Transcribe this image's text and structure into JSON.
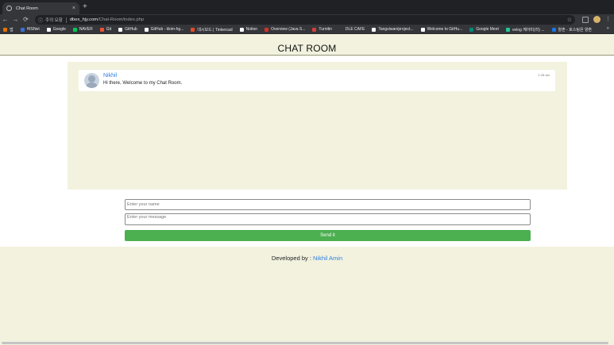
{
  "browser": {
    "tab_title": "Chat Room",
    "tab_close": "×",
    "new_tab": "+",
    "back": "←",
    "forward": "→",
    "reload": "⟳",
    "security_label": "주의 요함",
    "url_host": "dbex_hjy.com",
    "url_path": "/Chat-Room/index.php",
    "star": "☆",
    "more": "⋮",
    "bookmarks": [
      {
        "label": "앱",
        "color": "#e37400"
      },
      {
        "label": "HISNet",
        "color": "#3b6fd8"
      },
      {
        "label": "Google",
        "color": "#ffffff"
      },
      {
        "label": "NAVER",
        "color": "#03c75a"
      },
      {
        "label": "Git",
        "color": "#f05133"
      },
      {
        "label": "GitHub",
        "color": "#ffffff"
      },
      {
        "label": "GitHub - kkim-hg...",
        "color": "#ffffff"
      },
      {
        "label": "대시보드 | Tinkercad",
        "color": "#e84a27"
      },
      {
        "label": "Notion",
        "color": "#ffffff"
      },
      {
        "label": "Overview (Java S...",
        "color": "#d93025"
      },
      {
        "label": "Turnitin",
        "color": "#d33d3d"
      },
      {
        "label": "DLE CAFE",
        "color": "#35363a"
      },
      {
        "label": "Tangsiwan/project...",
        "color": "#ffffff"
      },
      {
        "label": "Welcome to GitHu...",
        "color": "#ffffff"
      },
      {
        "label": "Google Meet",
        "color": "#00897b"
      },
      {
        "label": "velog 께아미(라) ...",
        "color": "#20c997"
      },
      {
        "label": "양혼 - 호스팅은 양혼",
        "color": "#1a73e8"
      }
    ],
    "bookmarks_more": "»"
  },
  "page": {
    "title": "CHAT ROOM",
    "messages": [
      {
        "sender": "Nikhil",
        "text": "Hi there, Welcome to my Chat Room.",
        "time": "1:28 am"
      }
    ],
    "form": {
      "name_placeholder": "Enter your name",
      "message_placeholder": "Enter your message",
      "send_label": "Send it"
    },
    "footer": {
      "prefix": "Developed by : ",
      "author": "Nikhil Amin"
    }
  },
  "colors": {
    "accent_green": "#4caf50",
    "link_blue": "#2d7fe0",
    "page_background": "#f2f2df"
  }
}
